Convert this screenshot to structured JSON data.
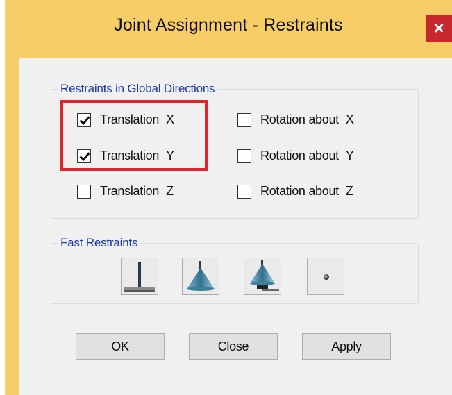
{
  "window": {
    "title": "Joint Assignment - Restraints",
    "close_glyph": "×",
    "frame_color": "#f6cd66",
    "close_color": "#c7282d"
  },
  "restraints_group": {
    "legend": "Restraints in Global Directions",
    "translation_x": {
      "label": "Translation",
      "axis": "X",
      "checked": true
    },
    "translation_y": {
      "label": "Translation",
      "axis": "Y",
      "checked": true
    },
    "translation_z": {
      "label": "Translation",
      "axis": "Z",
      "checked": false
    },
    "rotation_x": {
      "label": "Rotation about",
      "axis": "X",
      "checked": false
    },
    "rotation_y": {
      "label": "Rotation about",
      "axis": "Y",
      "checked": false
    },
    "rotation_z": {
      "label": "Rotation about",
      "axis": "Z",
      "checked": false
    }
  },
  "fast_restraints": {
    "legend": "Fast Restraints",
    "buttons": [
      "fixed-support-icon",
      "pinned-support-icon",
      "roller-support-icon",
      "free-joint-icon"
    ]
  },
  "actions": {
    "ok": "OK",
    "close": "Close",
    "apply": "Apply"
  },
  "highlight_color": "#e0252b"
}
